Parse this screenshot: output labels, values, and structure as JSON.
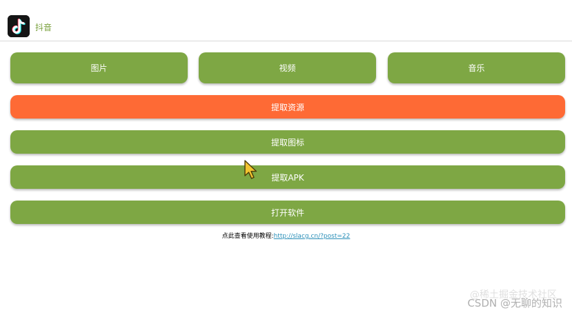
{
  "app": {
    "name": "抖音",
    "icon": "tiktok-logo-icon"
  },
  "tabs": [
    {
      "label": "图片"
    },
    {
      "label": "视频"
    },
    {
      "label": "音乐"
    }
  ],
  "actions": {
    "extract_resources": "提取资源",
    "extract_icon": "提取图标",
    "extract_apk": "提取APK",
    "open_app": "打开软件"
  },
  "tutorial": {
    "prefix": "点此查看使用教程:",
    "url": "http://slacg.cn/?post=22"
  },
  "watermark": {
    "text": "CSDN @无聊的知识",
    "ghost_text": "@稀土掘金技术社区"
  },
  "colors": {
    "green": "#7ea744",
    "orange": "#fe6a35",
    "link": "#2a8fb8"
  }
}
